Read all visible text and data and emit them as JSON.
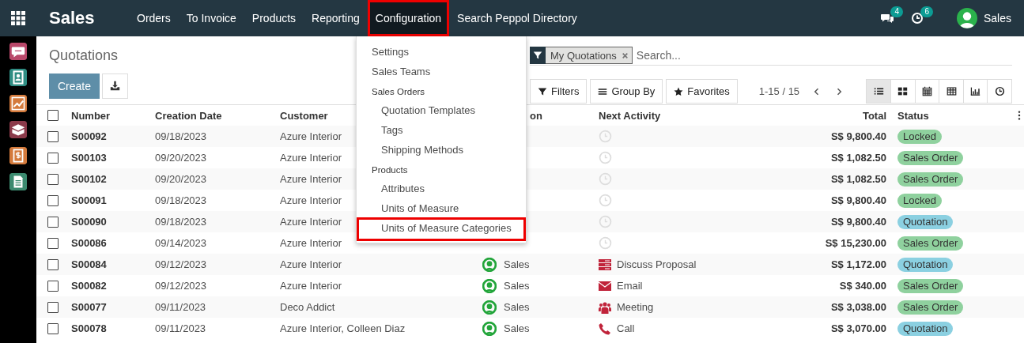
{
  "topbar": {
    "app_name": "Sales",
    "menu": [
      {
        "label": "Orders",
        "open": false,
        "highlighted": false
      },
      {
        "label": "To Invoice",
        "open": false,
        "highlighted": false
      },
      {
        "label": "Products",
        "open": false,
        "highlighted": false
      },
      {
        "label": "Reporting",
        "open": false,
        "highlighted": false
      },
      {
        "label": "Configuration",
        "open": true,
        "highlighted": true
      },
      {
        "label": "Search Peppol Directory",
        "open": false,
        "highlighted": false
      }
    ],
    "messages_badge": "4",
    "activities_badge": "6",
    "user": "Sales"
  },
  "dropdown": {
    "items": [
      {
        "kind": "item",
        "label": "Settings",
        "highlighted": false
      },
      {
        "kind": "item",
        "label": "Sales Teams",
        "highlighted": false
      },
      {
        "kind": "section",
        "label": "Sales Orders",
        "children": [
          {
            "kind": "item",
            "label": "Quotation Templates",
            "highlighted": false
          },
          {
            "kind": "item",
            "label": "Tags",
            "highlighted": false
          },
          {
            "kind": "item",
            "label": "Shipping Methods",
            "highlighted": false
          }
        ]
      },
      {
        "kind": "section",
        "label": "Products",
        "children": [
          {
            "kind": "item",
            "label": "Attributes",
            "highlighted": false
          },
          {
            "kind": "item",
            "label": "Units of Measure",
            "highlighted": false
          },
          {
            "kind": "item",
            "label": "Units of Measure Categories",
            "highlighted": true
          }
        ]
      }
    ]
  },
  "control_panel": {
    "title": "Quotations",
    "create_button": "Create",
    "search": {
      "facet": "My Quotations",
      "placeholder": "Search..."
    },
    "filters": [
      "Filters",
      "Group By",
      "Favorites"
    ],
    "pager": "1-15 / 15",
    "views": [
      {
        "kind": "list",
        "selected": true
      },
      {
        "kind": "kanban",
        "selected": false
      },
      {
        "kind": "calendar",
        "selected": false
      },
      {
        "kind": "pivot",
        "selected": false
      },
      {
        "kind": "graph",
        "selected": false
      },
      {
        "kind": "activity",
        "selected": false
      }
    ]
  },
  "table": {
    "select_all_checked": false,
    "columns": [
      "Number",
      "Creation Date",
      "Customer",
      "on",
      "Next Activity",
      "Total",
      "Status"
    ],
    "rows": [
      {
        "checked": false,
        "number": "S00092",
        "date": "09/18/2023",
        "customer": "Azure Interior",
        "activity": {
          "kind": "none"
        },
        "total": "S$ 9,800.40",
        "status": {
          "label": "Locked",
          "color": "#8fd19e"
        }
      },
      {
        "checked": false,
        "number": "S00103",
        "date": "09/20/2023",
        "customer": "Azure Interior",
        "activity": {
          "kind": "none"
        },
        "total": "S$ 1,082.50",
        "status": {
          "label": "Sales Order",
          "color": "#8fd19e"
        }
      },
      {
        "checked": false,
        "number": "S00102",
        "date": "09/20/2023",
        "customer": "Azure Interior",
        "activity": {
          "kind": "none"
        },
        "total": "S$ 1,082.50",
        "status": {
          "label": "Sales Order",
          "color": "#8fd19e"
        }
      },
      {
        "checked": false,
        "number": "S00091",
        "date": "09/18/2023",
        "customer": "Azure Interior",
        "activity": {
          "kind": "none"
        },
        "total": "S$ 9,800.40",
        "status": {
          "label": "Locked",
          "color": "#8fd19e"
        }
      },
      {
        "checked": false,
        "number": "S00090",
        "date": "09/18/2023",
        "customer": "Azure Interior",
        "activity": {
          "kind": "none"
        },
        "total": "S$ 9,800.40",
        "status": {
          "label": "Quotation",
          "color": "#8bd0e1"
        }
      },
      {
        "checked": false,
        "number": "S00086",
        "date": "09/14/2023",
        "customer": "Azure Interior",
        "activity": {
          "kind": "none"
        },
        "total": "S$ 15,230.00",
        "status": {
          "label": "Sales Order",
          "color": "#8fd19e"
        }
      },
      {
        "checked": false,
        "number": "S00084",
        "date": "09/12/2023",
        "customer": "Azure Interior",
        "salesperson": "Sales",
        "activity": {
          "kind": "proposal",
          "label": "Discuss Proposal"
        },
        "total": "S$ 1,172.00",
        "status": {
          "label": "Quotation",
          "color": "#8bd0e1"
        }
      },
      {
        "checked": false,
        "number": "S00082",
        "date": "09/12/2023",
        "customer": "Azure Interior",
        "salesperson": "Sales",
        "activity": {
          "kind": "email",
          "label": "Email"
        },
        "total": "S$ 340.00",
        "status": {
          "label": "Sales Order",
          "color": "#8fd19e"
        }
      },
      {
        "checked": false,
        "number": "S00077",
        "date": "09/11/2023",
        "customer": "Deco Addict",
        "salesperson": "Sales",
        "activity": {
          "kind": "meeting",
          "label": "Meeting"
        },
        "total": "S$ 3,038.00",
        "status": {
          "label": "Sales Order",
          "color": "#8fd19e"
        }
      },
      {
        "checked": false,
        "number": "S00078",
        "date": "09/11/2023",
        "customer": "Azure Interior, Colleen Diaz",
        "salesperson": "Sales",
        "activity": {
          "kind": "call",
          "label": "Call"
        },
        "total": "S$ 3,070.00",
        "status": {
          "label": "Quotation",
          "color": "#8bd0e1"
        }
      }
    ]
  }
}
